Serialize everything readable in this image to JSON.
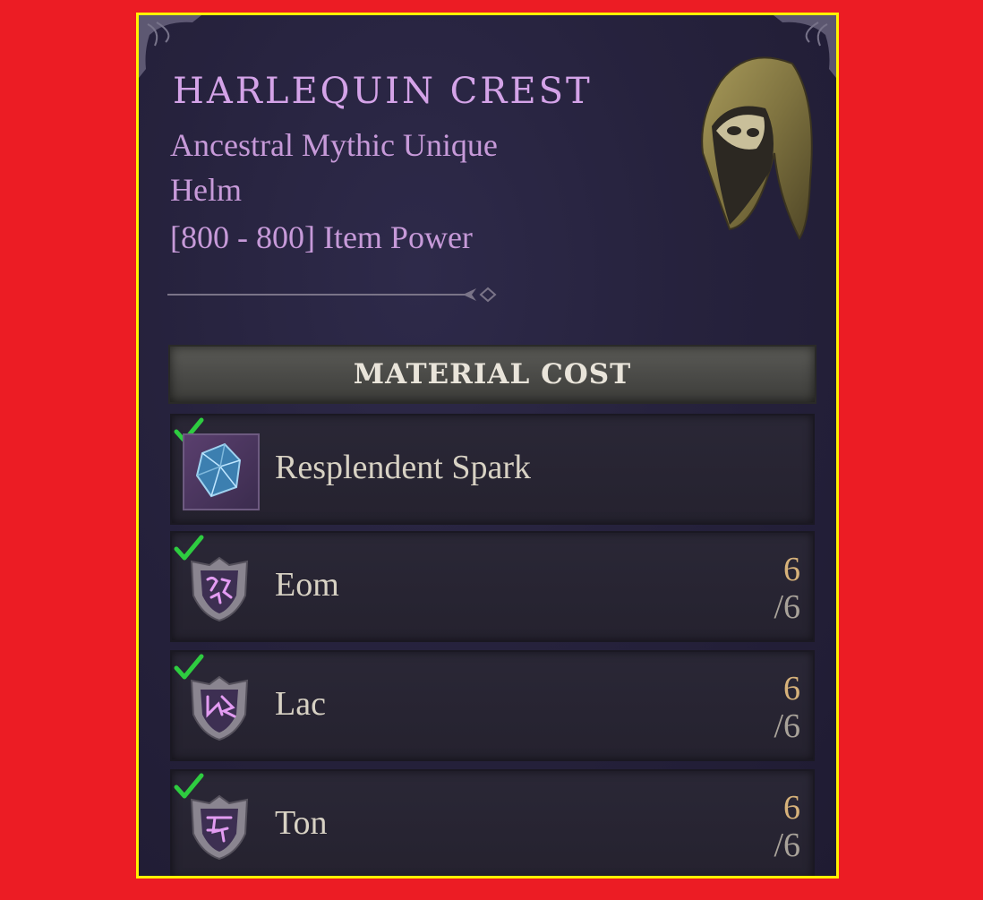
{
  "item": {
    "name": "HARLEQUIN CREST",
    "rarity": "Ancestral Mythic Unique",
    "slot": "Helm",
    "power": "[800 - 800] Item Power"
  },
  "materials": {
    "header": "MATERIAL COST",
    "rows": [
      {
        "name": "Resplendent Spark",
        "have": "",
        "need": "",
        "icon": "resplendent-spark-icon"
      },
      {
        "name": "Eom",
        "have": "6",
        "need": "/6",
        "icon": "eom-rune-icon"
      },
      {
        "name": "Lac",
        "have": "6",
        "need": "/6",
        "icon": "lac-rune-icon"
      },
      {
        "name": "Ton",
        "have": "6",
        "need": "/6",
        "icon": "ton-rune-icon"
      }
    ]
  },
  "colors": {
    "title": "#d4a3e8",
    "subtitle": "#c79ad9",
    "background": "#26223d",
    "check": "#2ecc40",
    "count_have": "#d7b27a",
    "outer": "#ec1c24",
    "highlight_border": "#fff200"
  }
}
